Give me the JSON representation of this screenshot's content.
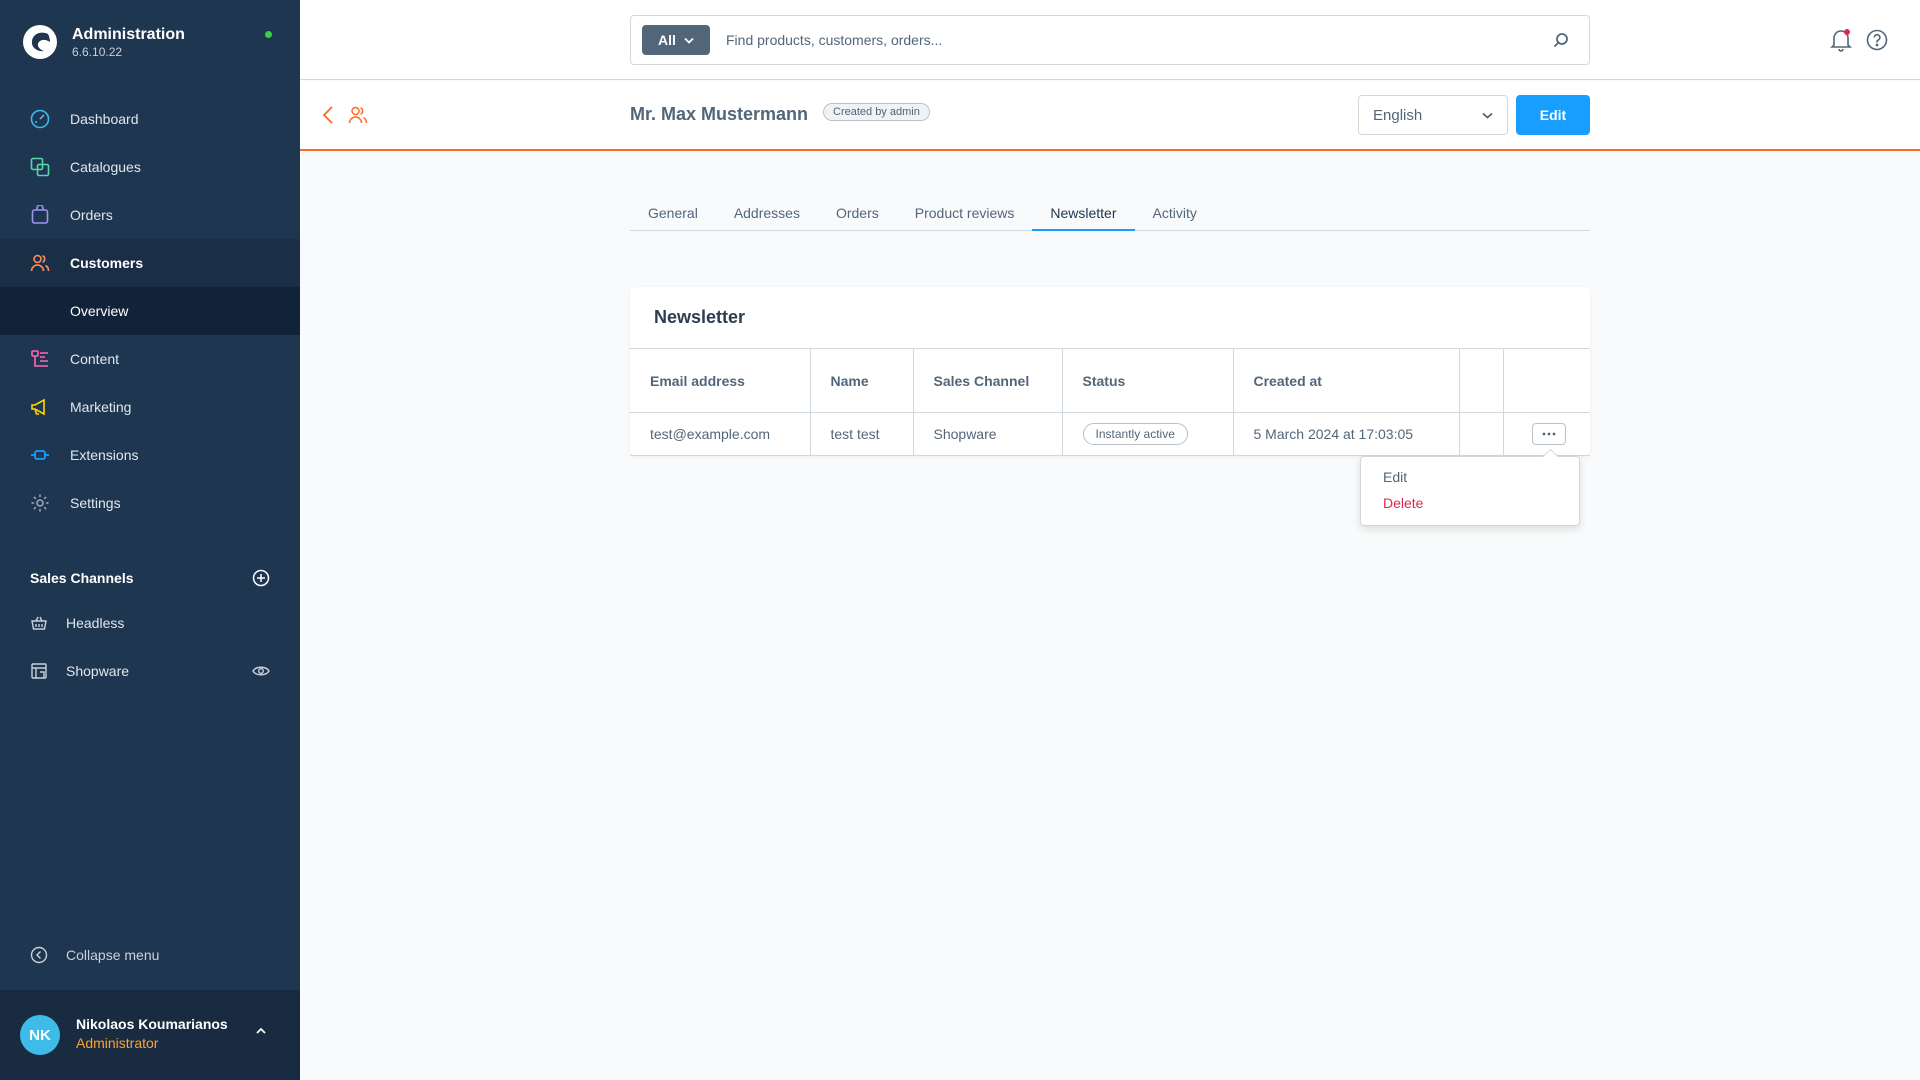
{
  "app": {
    "title": "Administration",
    "version": "6.6.10.22",
    "status_color": "#37d046"
  },
  "nav": {
    "items": [
      {
        "label": "Dashboard",
        "icon": "dashboard-icon"
      },
      {
        "label": "Catalogues",
        "icon": "catalogue-icon"
      },
      {
        "label": "Orders",
        "icon": "orders-icon"
      },
      {
        "label": "Customers",
        "icon": "customers-icon"
      },
      {
        "label": "Content",
        "icon": "content-icon"
      },
      {
        "label": "Marketing",
        "icon": "marketing-icon"
      },
      {
        "label": "Extensions",
        "icon": "extensions-icon"
      },
      {
        "label": "Settings",
        "icon": "settings-icon"
      }
    ],
    "sub_item": "Overview"
  },
  "sales_channels": {
    "title": "Sales Channels",
    "items": [
      {
        "label": "Headless",
        "icon": "basket-icon"
      },
      {
        "label": "Shopware",
        "icon": "storefront-icon"
      }
    ]
  },
  "collapse_label": "Collapse menu",
  "user": {
    "initials": "NK",
    "name": "Nikolaos Koumarianos",
    "role": "Administrator"
  },
  "search": {
    "type": "All",
    "placeholder": "Find products, customers, orders..."
  },
  "page": {
    "title": "Mr. Max Mustermann",
    "badge": "Created by admin",
    "language": "English",
    "edit_label": "Edit"
  },
  "tabs": [
    "General",
    "Addresses",
    "Orders",
    "Product reviews",
    "Newsletter",
    "Activity"
  ],
  "active_tab": "Newsletter",
  "newsletter": {
    "title": "Newsletter",
    "columns": [
      "Email address",
      "Name",
      "Sales Channel",
      "Status",
      "Created at"
    ],
    "rows": [
      {
        "email": "test@example.com",
        "name": "test test",
        "sales_channel": "Shopware",
        "status": "Instantly active",
        "created_at": "5 March 2024 at 17:03:05"
      }
    ]
  },
  "context_menu": {
    "edit": "Edit",
    "delete": "Delete"
  },
  "colors": {
    "sidebar": "#1f3651",
    "accent": "#189eff",
    "header_border": "#ff6a23",
    "danger": "#de294c",
    "role": "#ffa32e"
  }
}
